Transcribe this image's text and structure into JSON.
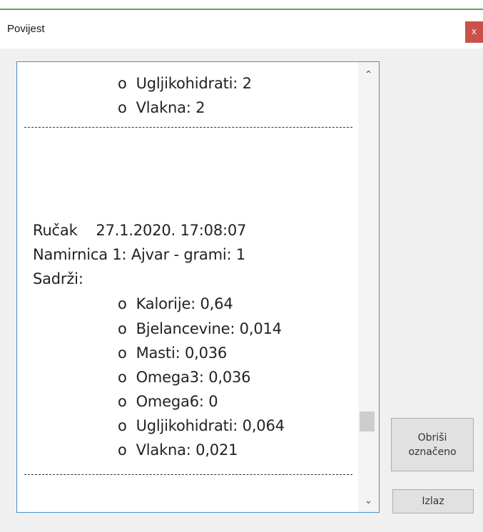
{
  "window": {
    "title": "Povijest",
    "close_label": "x"
  },
  "history": {
    "lines": [
      {
        "kind": "bullet",
        "text": "o  Ugljikohidrati: 2"
      },
      {
        "kind": "bullet",
        "text": "o  Vlakna: 2"
      },
      {
        "kind": "separator"
      },
      {
        "kind": "plain",
        "text": "Ručak    27.1.2020. 17:08:07"
      },
      {
        "kind": "plain",
        "text": "Namirnica 1: Ajvar - grami: 1"
      },
      {
        "kind": "plain",
        "text": "Sadrži:"
      },
      {
        "kind": "bullet",
        "text": "o  Kalorije: 0,64"
      },
      {
        "kind": "bullet",
        "text": "o  Bjelancevine: 0,014"
      },
      {
        "kind": "bullet",
        "text": "o  Masti: 0,036"
      },
      {
        "kind": "bullet",
        "text": "o  Omega3: 0,036"
      },
      {
        "kind": "bullet",
        "text": "o  Omega6: 0"
      },
      {
        "kind": "bullet",
        "text": "o  Ugljikohidrati: 0,064"
      },
      {
        "kind": "bullet",
        "text": "o  Vlakna: 0,021"
      },
      {
        "kind": "separator"
      }
    ]
  },
  "scrollbar": {
    "up_icon": "chevron-up-icon",
    "down_icon": "chevron-down-icon",
    "position": 0.82
  },
  "buttons": {
    "delete_label_1": "Obriši",
    "delete_label_2": "označeno",
    "exit_label": "Izlaz"
  }
}
